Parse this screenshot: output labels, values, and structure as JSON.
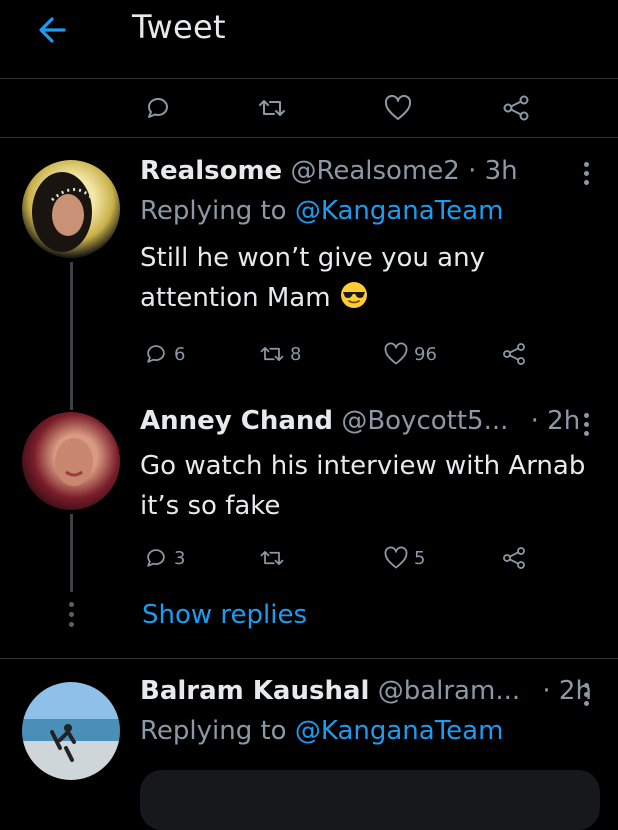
{
  "header": {
    "title": "Tweet",
    "back_icon": "back-arrow-icon",
    "accent": "#1d9bf0"
  },
  "main_tweet_actions": {
    "icons": [
      "reply-icon",
      "retweet-icon",
      "like-icon",
      "share-icon"
    ]
  },
  "replies": [
    {
      "name": "Realsome",
      "handle": "@Realsome2 · 3h",
      "replying_to_prefix": "Replying to",
      "replying_to": "@KanganaTeam",
      "text_line1": "Still he won’t give you any",
      "text_line2": "attention Mam",
      "emoji": "smiling-face-with-sunglasses",
      "reply_count": "6",
      "retweet_count": "8",
      "like_count": "96"
    },
    {
      "name": "Anney Chand",
      "handle": "@Boycott5...",
      "time": "· 2h",
      "text_line1": "Go watch his interview with Arnab",
      "text_line2": "it’s so fake",
      "reply_count": "3",
      "retweet_count": "",
      "like_count": "5",
      "show_replies": "Show replies"
    },
    {
      "name": "Balram Kaushal",
      "handle": "@balram...",
      "time": "· 2h",
      "replying_to_prefix": "Replying to",
      "replying_to": "@KanganaTeam"
    }
  ],
  "colors": {
    "background": "#000000",
    "text": "#e7e9ea",
    "muted": "#8b98a5",
    "link": "#1d9bf0"
  }
}
